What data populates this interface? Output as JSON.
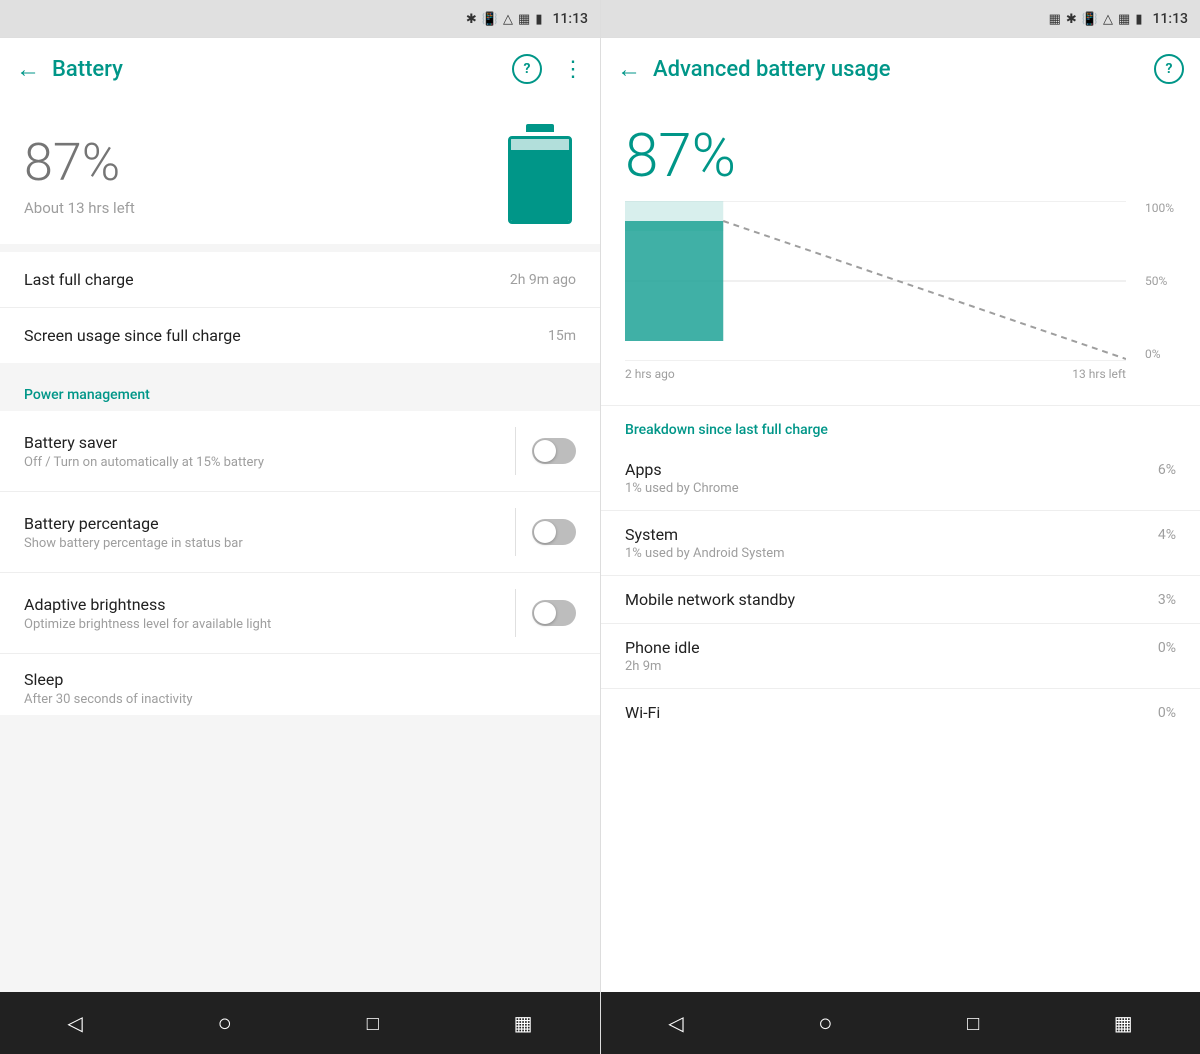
{
  "leftPanel": {
    "statusBar": {
      "time": "11:13"
    },
    "appBar": {
      "title": "Battery",
      "backLabel": "←",
      "helpLabel": "?",
      "moreLabel": "⋮"
    },
    "summary": {
      "percentage": "87%",
      "timeLeft": "About 13 hrs left",
      "batteryFillPercent": 87
    },
    "infoRows": [
      {
        "label": "Last full charge",
        "value": "2h 9m ago"
      },
      {
        "label": "Screen usage since full charge",
        "value": "15m"
      }
    ],
    "sectionHeader": "Power management",
    "toggleRows": [
      {
        "title": "Battery saver",
        "subtitle": "Off / Turn on automatically at 15% battery",
        "on": false
      },
      {
        "title": "Battery percentage",
        "subtitle": "Show battery percentage in status bar",
        "on": false
      },
      {
        "title": "Adaptive brightness",
        "subtitle": "Optimize brightness level for available light",
        "on": false
      }
    ],
    "sleepRow": {
      "title": "Sleep",
      "subtitle": "After 30 seconds of inactivity"
    },
    "navBar": {
      "back": "◁",
      "home": "○",
      "recents": "□",
      "menu": "▦"
    }
  },
  "rightPanel": {
    "statusBar": {
      "time": "11:13"
    },
    "appBar": {
      "title": "Advanced battery usage",
      "backLabel": "←",
      "helpLabel": "?"
    },
    "percentage": "87%",
    "chart": {
      "leftLabel": "2 hrs ago",
      "rightLabel": "13 hrs left",
      "labels100": "100%",
      "labels50": "50%",
      "labels0": "0%"
    },
    "breakdownHeader": "Breakdown since last full charge",
    "breakdownRows": [
      {
        "title": "Apps",
        "subtitle": "1% used by Chrome",
        "pct": "6%"
      },
      {
        "title": "System",
        "subtitle": "1% used by Android System",
        "pct": "4%"
      },
      {
        "title": "Mobile network standby",
        "subtitle": "",
        "pct": "3%"
      },
      {
        "title": "Phone idle",
        "subtitle": "2h 9m",
        "pct": "0%"
      },
      {
        "title": "Wi-Fi",
        "subtitle": "",
        "pct": "0%"
      }
    ],
    "navBar": {
      "back": "◁",
      "home": "○",
      "recents": "□",
      "menu": "▦"
    }
  }
}
